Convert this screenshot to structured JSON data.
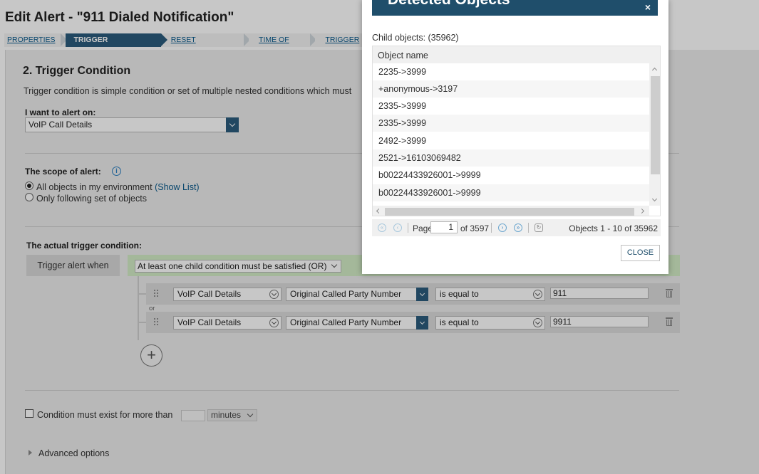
{
  "page": {
    "title": "Edit Alert - \"911 Dialed Notification\""
  },
  "steps": [
    {
      "label": "PROPERTIES"
    },
    {
      "label": "TRIGGER CONDITION"
    },
    {
      "label": "RESET CONDITION"
    },
    {
      "label": "TIME OF DAY"
    },
    {
      "label": "TRIGGER ACTIONS"
    }
  ],
  "trigger_section": {
    "title": "2. Trigger Condition",
    "description": "Trigger condition is simple condition or set of multiple nested conditions which must",
    "alert_on_label": "I want to alert on:",
    "alert_on_value": "VoIP Call Details",
    "scope_label": "The scope of alert:",
    "scope_option_all": "All objects in my environment",
    "scope_show_list": "(Show List)",
    "scope_option_some": "Only following set of objects",
    "actual_label": "The actual trigger condition:",
    "trigger_when": "Trigger alert when",
    "group_operator": "At least one child condition must be satisfied (OR)",
    "or_label": "or",
    "conditions": [
      {
        "object": "VoIP Call Details",
        "field": "Original Called Party Number",
        "operator": "is equal to",
        "value": "911"
      },
      {
        "object": "VoIP Call Details",
        "field": "Original Called Party Number",
        "operator": "is equal to",
        "value": "9911"
      }
    ],
    "add_icon": "+",
    "exist_label": "Condition must exist for more than",
    "exist_units": "minutes",
    "advanced_label": "Advanced options"
  },
  "dialog": {
    "title": "Detected Objects",
    "close_x": "×",
    "child_count_label": "Child objects: (35962)",
    "column_header": "Object name",
    "rows": [
      "2235->3999",
      "+anonymous->3197",
      "2335->3999",
      "2335->3999",
      "2492->3999",
      "2521->16103069482",
      "b00224433926001->9999",
      "b00224433926001->9999"
    ],
    "pager": {
      "page_label": "Page",
      "page_value": "1",
      "of_label": "of 3597",
      "summary": "Objects 1 - 10 of 35962"
    },
    "close_button": "CLOSE"
  }
}
